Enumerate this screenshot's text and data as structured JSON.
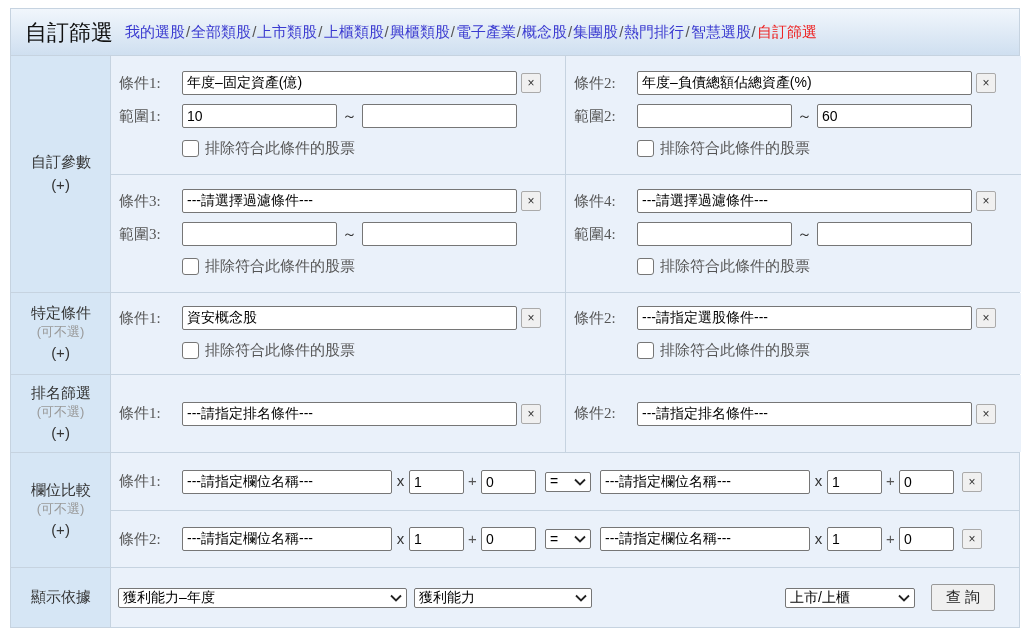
{
  "header": {
    "title": "自訂篩選",
    "nav": [
      {
        "label": "我的選股",
        "selected": false,
        "separator": "/"
      },
      {
        "label": "全部類股",
        "selected": false,
        "separator": "/"
      },
      {
        "label": "上市類股",
        "selected": false,
        "separator": "/"
      },
      {
        "label": "上櫃類股",
        "selected": false,
        "separator": "/"
      },
      {
        "label": "興櫃類股",
        "selected": false,
        "separator": "/"
      },
      {
        "label": "電子產業",
        "selected": false,
        "separator": "/"
      },
      {
        "label": "概念股",
        "selected": false,
        "separator": "/"
      },
      {
        "label": "集團股",
        "selected": false,
        "separator": "/"
      },
      {
        "label": "熱門排行",
        "selected": false,
        "separator": "/"
      },
      {
        "label": "智慧選股",
        "selected": false,
        "separator": "/"
      },
      {
        "label": "自訂篩選",
        "selected": true
      }
    ]
  },
  "custom_params": {
    "label": "自訂參數",
    "add": "(+)",
    "groups": [
      {
        "conditions": [
          {
            "condition_label": "條件1:",
            "condition_value": "年度–固定資產(億)",
            "clear": "×",
            "range_label": "範圍1:",
            "range_from": "10",
            "tilde": "～",
            "exclude_label": "排除符合此條件的股票",
            "exclude_checked": false
          },
          {
            "condition_label": "條件2:",
            "condition_value": "年度–負債總額佔總資產(%)",
            "clear": "×",
            "range_label": "範圍2:",
            "range_to": "60",
            "tilde": "～",
            "exclude_label": "排除符合此條件的股票",
            "exclude_checked": false
          }
        ]
      },
      {
        "conditions": [
          {
            "condition_label": "條件3:",
            "condition_value": "---請選擇過濾條件---",
            "clear": "×",
            "range_label": "範圍3:",
            "tilde": "～",
            "exclude_label": "排除符合此條件的股票",
            "exclude_checked": false
          },
          {
            "condition_label": "條件4:",
            "condition_value": "---請選擇過濾條件---",
            "clear": "×",
            "range_label": "範圍4:",
            "tilde": "～",
            "exclude_label": "排除符合此條件的股票",
            "exclude_checked": false
          }
        ]
      }
    ]
  },
  "specific": {
    "label": "特定條件",
    "note": "(可不選)",
    "add": "(+)",
    "conditions": [
      {
        "condition_label": "條件1:",
        "condition_value": "資安概念股",
        "clear": "×",
        "exclude_label": "排除符合此條件的股票",
        "exclude_checked": false
      },
      {
        "condition_label": "條件2:",
        "condition_value": "---請指定選股條件---",
        "clear": "×",
        "exclude_label": "排除符合此條件的股票",
        "exclude_checked": false
      }
    ]
  },
  "ranking": {
    "label": "排名篩選",
    "note": "(可不選)",
    "add": "(+)",
    "conditions": [
      {
        "condition_label": "條件1:",
        "condition_value": "---請指定排名條件---",
        "clear": "×"
      },
      {
        "condition_label": "條件2:",
        "condition_value": "---請指定排名條件---",
        "clear": "×"
      }
    ]
  },
  "field_compare": {
    "label": "欄位比較",
    "note": "(可不選)",
    "add": "(+)",
    "rows": [
      {
        "condition_label": "條件1:",
        "left_field": "---請指定欄位名稱---",
        "left_times": "x",
        "left_mult": "1",
        "left_plus": "+",
        "left_add": "0",
        "operator": "=",
        "right_field": "---請指定欄位名稱---",
        "right_times": "x",
        "right_mult": "1",
        "right_plus": "+",
        "right_add": "0",
        "clear": "×"
      },
      {
        "condition_label": "條件2:",
        "left_field": "---請指定欄位名稱---",
        "left_times": "x",
        "left_mult": "1",
        "left_plus": "+",
        "left_add": "0",
        "operator": "=",
        "right_field": "---請指定欄位名稱---",
        "right_times": "x",
        "right_mult": "1",
        "right_plus": "+",
        "right_add": "0",
        "clear": "×"
      }
    ]
  },
  "display": {
    "label": "顯示依據",
    "select_1": "獲利能力–年度",
    "select_2": "獲利能力",
    "market": "上市/上櫃",
    "query_button": "查 詢"
  }
}
